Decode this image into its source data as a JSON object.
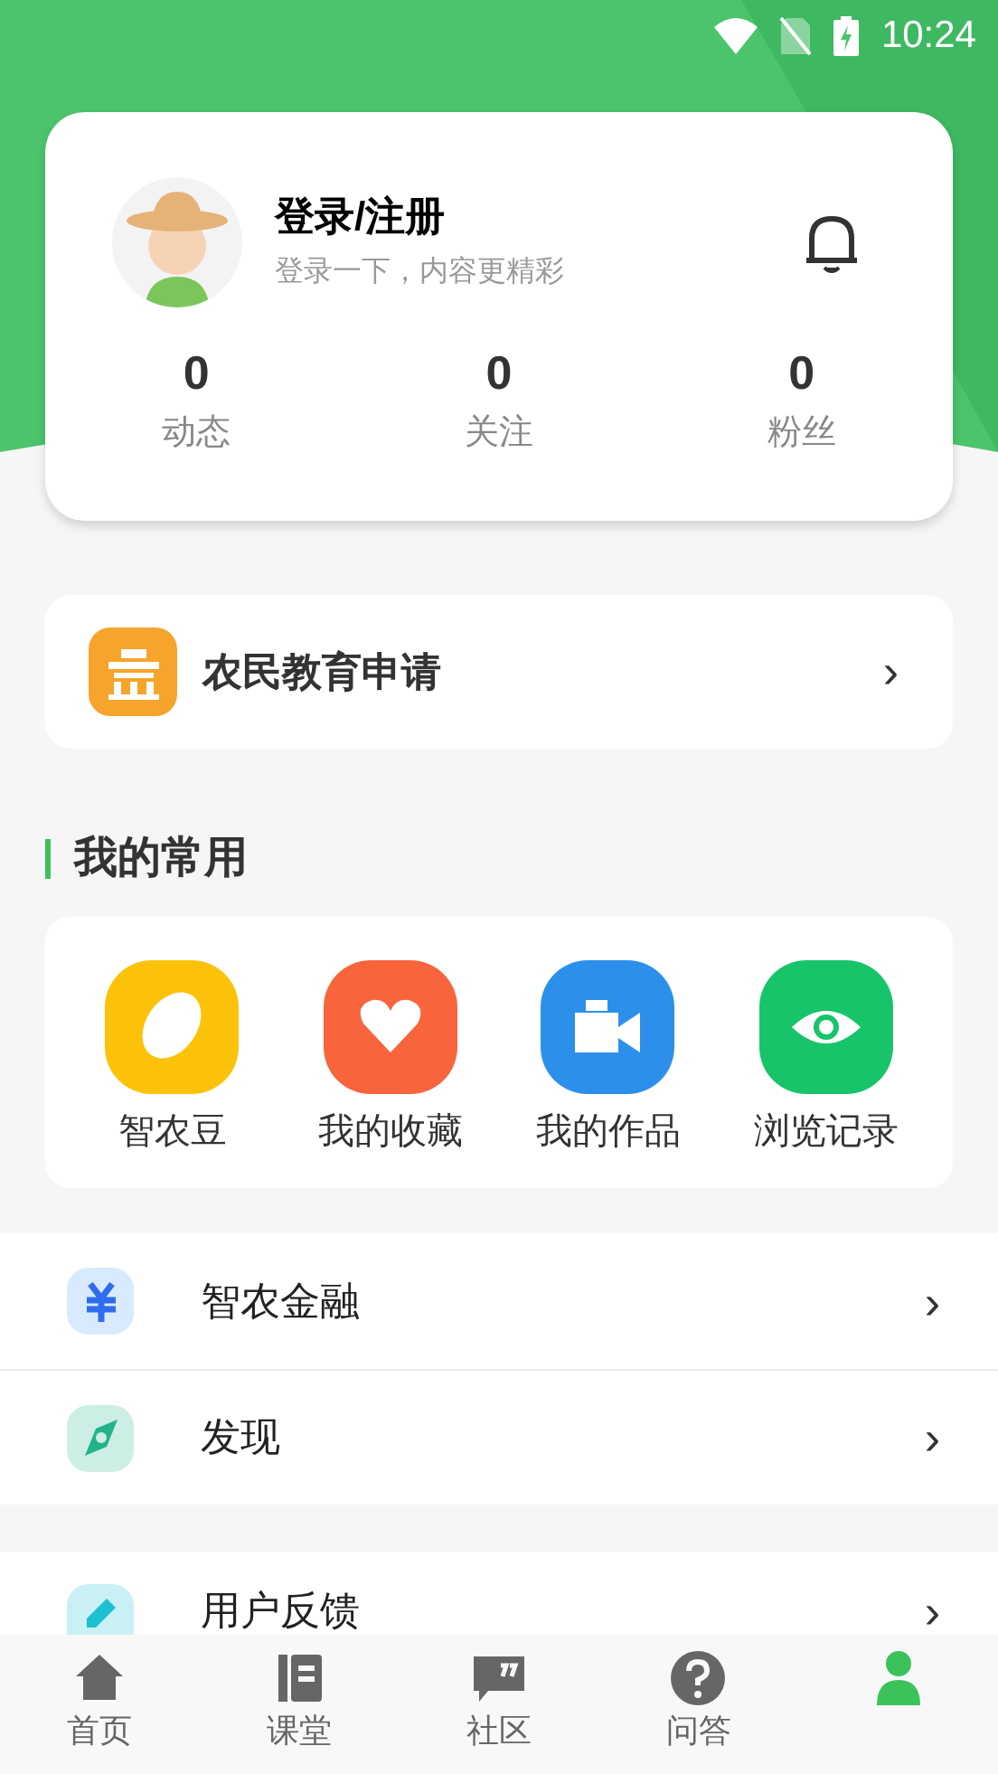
{
  "status_bar": {
    "time": "10:24"
  },
  "profile": {
    "title": "登录/注册",
    "subtitle": "登录一下，内容更精彩",
    "stats": [
      {
        "value": "0",
        "label": "动态"
      },
      {
        "value": "0",
        "label": "关注"
      },
      {
        "value": "0",
        "label": "粉丝"
      }
    ]
  },
  "education": {
    "label": "农民教育申请",
    "chevron": "›"
  },
  "favorites": {
    "title": "我的常用",
    "items": [
      {
        "kind": "bean",
        "label": "智农豆"
      },
      {
        "kind": "heart",
        "label": "我的收藏"
      },
      {
        "kind": "video",
        "label": "我的作品"
      },
      {
        "kind": "eye",
        "label": "浏览记录"
      }
    ]
  },
  "menu_groups": [
    [
      {
        "kind": "finance",
        "label": "智农金融",
        "chevron": "›"
      },
      {
        "kind": "compass",
        "label": "发现",
        "chevron": "›"
      }
    ],
    [
      {
        "kind": "edit",
        "label": "用户反馈",
        "chevron": "›"
      }
    ]
  ],
  "tab_bar": [
    {
      "kind": "home",
      "label": "首页",
      "selected": false
    },
    {
      "kind": "book",
      "label": "课堂",
      "selected": false
    },
    {
      "kind": "chat",
      "label": "社区",
      "selected": false
    },
    {
      "kind": "help",
      "label": "问答",
      "selected": false
    },
    {
      "kind": "person",
      "selected": true
    }
  ]
}
